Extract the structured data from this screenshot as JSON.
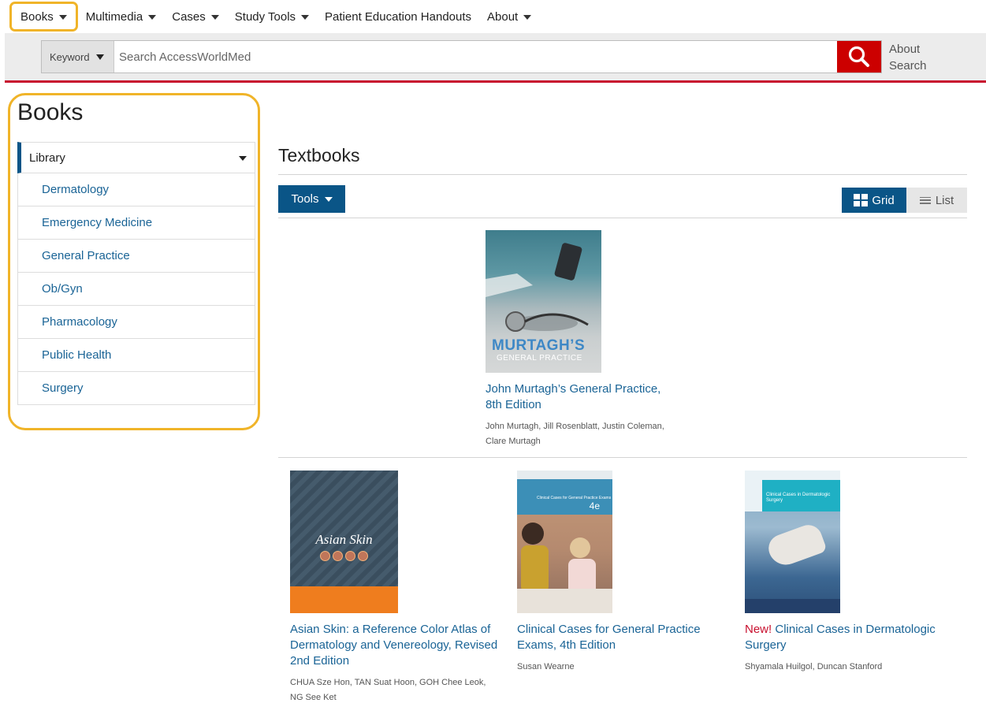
{
  "nav": {
    "items": [
      {
        "label": "Books",
        "has_dropdown": true,
        "highlighted": true
      },
      {
        "label": "Multimedia",
        "has_dropdown": true
      },
      {
        "label": "Cases",
        "has_dropdown": true
      },
      {
        "label": "Study Tools",
        "has_dropdown": true
      },
      {
        "label": "Patient Education Handouts",
        "has_dropdown": false
      },
      {
        "label": "About",
        "has_dropdown": true
      }
    ]
  },
  "search": {
    "scope": "Keyword",
    "placeholder": "Search AccessWorldMed",
    "value": "",
    "button_icon": "search-icon",
    "about_line1": "About",
    "about_line2": "Search"
  },
  "sidebar": {
    "title": "Books",
    "library_label": "Library",
    "items": [
      "Dermatology",
      "Emergency Medicine",
      "General Practice",
      "Ob/Gyn",
      "Pharmacology",
      "Public Health",
      "Surgery"
    ]
  },
  "main": {
    "title": "Textbooks",
    "tools_label": "Tools",
    "view_grid_label": "Grid",
    "view_list_label": "List",
    "active_view": "Grid"
  },
  "books": [
    {
      "title": "John Murtagh’s General Practice, 8th Edition",
      "new_flag": "",
      "authors": "John Murtagh, Jill Rosenblatt, Justin Coleman, Clare Murtagh",
      "cover_text_1": "MURTAGH’S",
      "cover_text_2": "GENERAL PRACTICE"
    },
    {
      "title": "Asian Skin: a Reference Color Atlas of Dermatology and Venereology, Revised 2nd Edition",
      "new_flag": "",
      "authors": "CHUA Sze Hon, TAN Suat Hoon, GOH Chee Leok, NG See Ket",
      "cover_text_1": "Asian Skin"
    },
    {
      "title": "Clinical Cases for General Practice Exams, 4th Edition",
      "new_flag": "",
      "authors": "Susan Wearne",
      "cover_text_1": "Clinical Cases for General Practice Exams",
      "cover_text_2": "4e"
    },
    {
      "title": "Clinical Cases in Dermatologic Surgery",
      "new_flag": "New!",
      "authors": "Shyamala Huilgol, Duncan Stanford",
      "cover_text_1": "Clinical Cases in Dermatologic Surgery"
    }
  ],
  "colors": {
    "brand_blue": "#0a5587",
    "link_blue": "#1a6496",
    "accent_red": "#c8102e",
    "highlight": "#f0b429"
  }
}
